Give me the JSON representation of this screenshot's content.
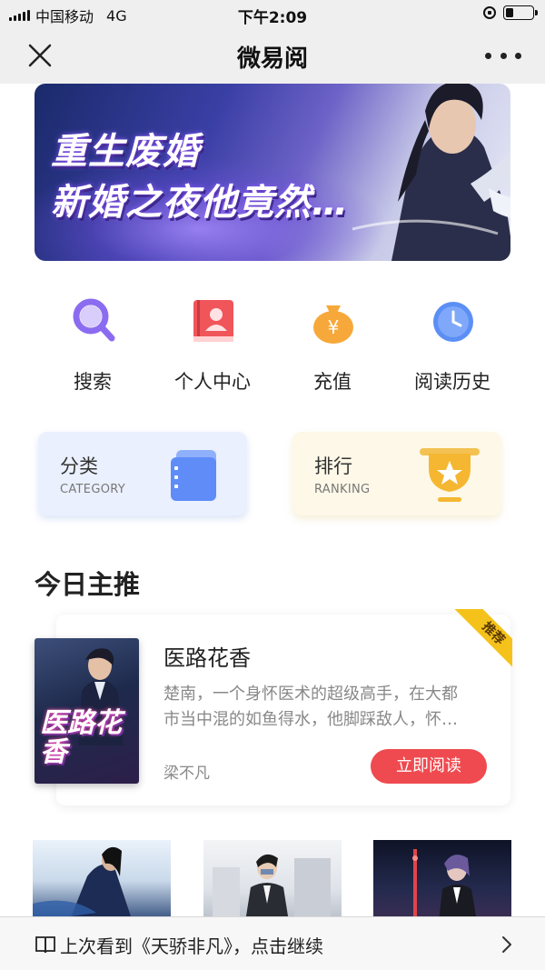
{
  "status_bar": {
    "carrier": "中国移动",
    "network": "4G",
    "time": "下午2:09",
    "battery_level": 0.3
  },
  "nav": {
    "title": "微易阅",
    "close_icon": "close-icon",
    "more_icon": "more-dots-icon"
  },
  "banner": {
    "line1": "重生废婚",
    "line2": "新婚之夜他竟然…"
  },
  "actions": [
    {
      "label": "搜索",
      "icon": "search-icon",
      "color": "#8b6cf0"
    },
    {
      "label": "个人中心",
      "icon": "profile-book-icon",
      "color": "#f0555a"
    },
    {
      "label": "充值",
      "icon": "money-bag-icon",
      "color": "#f7a83a"
    },
    {
      "label": "阅读历史",
      "icon": "clock-icon",
      "color": "#5b8ff5"
    }
  ],
  "cards": {
    "category": {
      "title": "分类",
      "subtitle": "CATEGORY",
      "icon": "folder-icon"
    },
    "ranking": {
      "title": "排行",
      "subtitle": "RANKING",
      "icon": "trophy-icon"
    }
  },
  "section": {
    "title": "今日主推"
  },
  "featured": {
    "ribbon": "推荐",
    "title": "医路花香",
    "cover_title": "医路花香",
    "desc_line1": "楚南，一个身怀医术的超级高手，在大都",
    "desc_line2": "市当中混的如鱼得水，他脚踩敌人，怀…",
    "author": "梁不凡",
    "read_button": "立即阅读"
  },
  "continue": {
    "text": "上次看到《天骄非凡》，点击继续"
  },
  "colors": {
    "accent_red": "#ef4a4f",
    "ribbon_yellow": "#f5c21b",
    "nav_bg": "#efefef"
  }
}
